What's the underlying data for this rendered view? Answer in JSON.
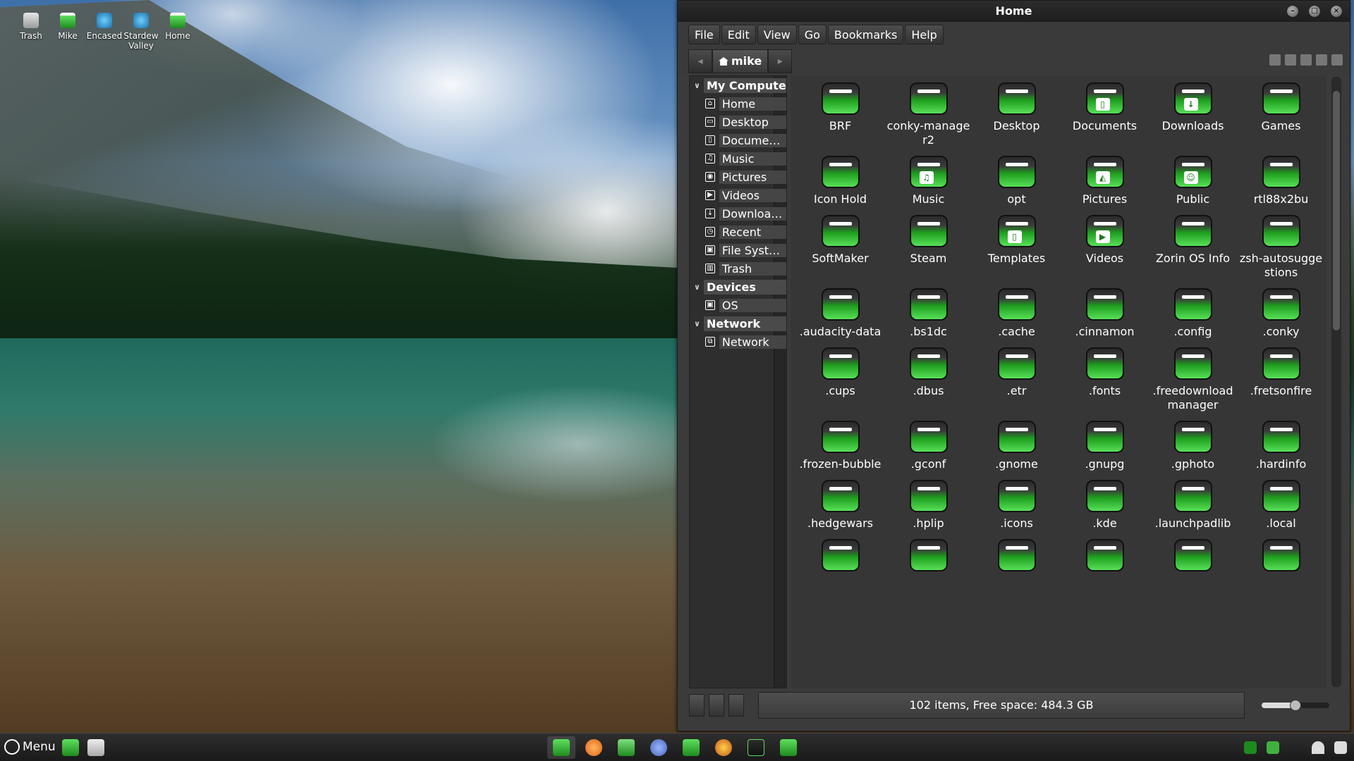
{
  "desktop": {
    "icons": [
      {
        "label": "Trash",
        "icon": "trash-icon"
      },
      {
        "label": "Mike",
        "icon": "folder-icon"
      },
      {
        "label": "Encased",
        "icon": "app-icon"
      },
      {
        "label": "Stardew Valley",
        "icon": "app-icon"
      },
      {
        "label": "Home",
        "icon": "folder-icon"
      }
    ]
  },
  "window": {
    "title": "Home",
    "menu": [
      "File",
      "Edit",
      "View",
      "Go",
      "Bookmarks",
      "Help"
    ],
    "path": "mike"
  },
  "sidebar": {
    "sections": [
      {
        "heading": "My Computer",
        "items": [
          {
            "label": "Home",
            "icon": "home-icon",
            "glyph": "⌂"
          },
          {
            "label": "Desktop",
            "icon": "desktop-icon",
            "glyph": "▭"
          },
          {
            "label": "Documents",
            "icon": "document-icon",
            "glyph": "▯"
          },
          {
            "label": "Music",
            "icon": "music-icon",
            "glyph": "♫"
          },
          {
            "label": "Pictures",
            "icon": "camera-icon",
            "glyph": "◉"
          },
          {
            "label": "Videos",
            "icon": "video-icon",
            "glyph": "▶"
          },
          {
            "label": "Downloads",
            "icon": "download-icon",
            "glyph": "↓"
          },
          {
            "label": "Recent",
            "icon": "clock-icon",
            "glyph": "◷"
          },
          {
            "label": "File System",
            "icon": "drive-icon",
            "glyph": "▣"
          },
          {
            "label": "Trash",
            "icon": "trash-icon",
            "glyph": "▥"
          }
        ]
      },
      {
        "heading": "Devices",
        "items": [
          {
            "label": "OS",
            "icon": "drive-icon",
            "glyph": "▣"
          }
        ]
      },
      {
        "heading": "Network",
        "items": [
          {
            "label": "Network",
            "icon": "network-icon",
            "glyph": "⧉"
          }
        ]
      }
    ]
  },
  "files": [
    {
      "name": "BRF",
      "emblem": ""
    },
    {
      "name": "conky-manager2",
      "emblem": ""
    },
    {
      "name": "Desktop",
      "emblem": ""
    },
    {
      "name": "Documents",
      "emblem": "▯"
    },
    {
      "name": "Downloads",
      "emblem": "↓"
    },
    {
      "name": "Games",
      "emblem": ""
    },
    {
      "name": "Icon Hold",
      "emblem": ""
    },
    {
      "name": "Music",
      "emblem": "♫"
    },
    {
      "name": "opt",
      "emblem": ""
    },
    {
      "name": "Pictures",
      "emblem": "◭"
    },
    {
      "name": "Public",
      "emblem": "☺"
    },
    {
      "name": "rtl88x2bu",
      "emblem": ""
    },
    {
      "name": "SoftMaker",
      "emblem": ""
    },
    {
      "name": "Steam",
      "emblem": ""
    },
    {
      "name": "Templates",
      "emblem": "▯"
    },
    {
      "name": "Videos",
      "emblem": "▶"
    },
    {
      "name": "Zorin OS Info",
      "emblem": ""
    },
    {
      "name": "zsh-autosuggestions",
      "emblem": ""
    },
    {
      "name": ".audacity-data",
      "emblem": ""
    },
    {
      "name": ".bs1dc",
      "emblem": ""
    },
    {
      "name": ".cache",
      "emblem": ""
    },
    {
      "name": ".cinnamon",
      "emblem": ""
    },
    {
      "name": ".config",
      "emblem": ""
    },
    {
      "name": ".conky",
      "emblem": ""
    },
    {
      "name": ".cups",
      "emblem": ""
    },
    {
      "name": ".dbus",
      "emblem": ""
    },
    {
      "name": ".etr",
      "emblem": ""
    },
    {
      "name": ".fonts",
      "emblem": ""
    },
    {
      "name": ".freedownloadmanager",
      "emblem": ""
    },
    {
      "name": ".fretsonfire",
      "emblem": ""
    },
    {
      "name": ".frozen-bubble",
      "emblem": ""
    },
    {
      "name": ".gconf",
      "emblem": ""
    },
    {
      "name": ".gnome",
      "emblem": ""
    },
    {
      "name": ".gnupg",
      "emblem": ""
    },
    {
      "name": ".gphoto",
      "emblem": ""
    },
    {
      "name": ".hardinfo",
      "emblem": ""
    },
    {
      "name": ".hedgewars",
      "emblem": ""
    },
    {
      "name": ".hplip",
      "emblem": ""
    },
    {
      "name": ".icons",
      "emblem": ""
    },
    {
      "name": ".kde",
      "emblem": ""
    },
    {
      "name": ".launchpadlib",
      "emblem": ""
    },
    {
      "name": ".local",
      "emblem": ""
    },
    {
      "name": "",
      "emblem": ""
    },
    {
      "name": "",
      "emblem": ""
    },
    {
      "name": "",
      "emblem": ""
    },
    {
      "name": "",
      "emblem": ""
    },
    {
      "name": "",
      "emblem": ""
    },
    {
      "name": "",
      "emblem": ""
    }
  ],
  "status": {
    "text": "102 items, Free space: 484.3 GB",
    "zoom_level": 0.5
  },
  "taskbar": {
    "menu_label": "Menu"
  }
}
